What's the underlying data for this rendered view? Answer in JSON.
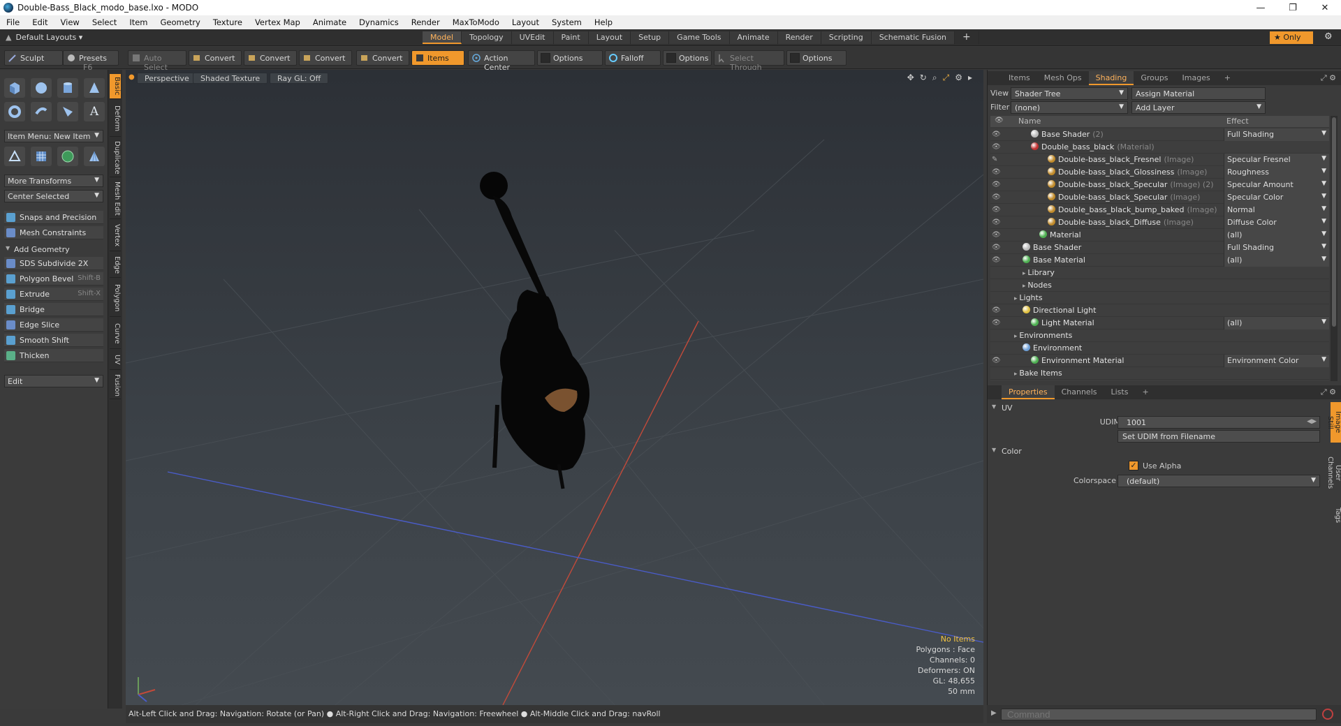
{
  "window": {
    "title": "Double-Bass_Black_modo_base.lxo - MODO",
    "minimize": "—",
    "maximize": "❐",
    "close": "✕"
  },
  "menu": [
    "File",
    "Edit",
    "View",
    "Select",
    "Item",
    "Geometry",
    "Texture",
    "Vertex Map",
    "Animate",
    "Dynamics",
    "Render",
    "MaxToModo",
    "Layout",
    "System",
    "Help"
  ],
  "layoutbar": {
    "default_layouts": "Default Layouts ▾",
    "tabs": [
      "Model",
      "Topology",
      "UVEdit",
      "Paint",
      "Layout",
      "Setup",
      "Game Tools",
      "Animate",
      "Render",
      "Scripting",
      "Schematic Fusion"
    ],
    "active_tab": "Model",
    "add": "+",
    "only": "★  Only",
    "gear": "⚙"
  },
  "toolbar": {
    "sculpt": "Sculpt",
    "presets": "Presets",
    "presets_key": "F6",
    "auto_select": "Auto Select",
    "convert1": "Convert",
    "convert2": "Convert",
    "convert3": "Convert",
    "convert4": "Convert",
    "items": "Items",
    "action_center": "Action Center",
    "options1": "Options",
    "falloff": "Falloff",
    "options2": "Options",
    "select_through": "Select Through",
    "options3": "Options"
  },
  "leftpanel": {
    "item_menu": "Item Menu: New Item",
    "more_transforms": "More Transforms",
    "center_selected": "Center Selected",
    "snaps": "Snaps and Precision",
    "mesh_constraints": "Mesh Constraints",
    "add_geometry": "Add Geometry",
    "tools": [
      {
        "label": "SDS Subdivide 2X",
        "key": "",
        "color": "#6a8cc8"
      },
      {
        "label": "Polygon Bevel",
        "key": "Shift-B",
        "color": "#5aa0d0"
      },
      {
        "label": "Extrude",
        "key": "Shift-X",
        "color": "#5aa0d0"
      },
      {
        "label": "Bridge",
        "key": "",
        "color": "#5aa0d0"
      },
      {
        "label": "Edge Slice",
        "key": "",
        "color": "#6a8cc8"
      },
      {
        "label": "Smooth Shift",
        "key": "",
        "color": "#5aa0d0"
      },
      {
        "label": "Thicken",
        "key": "",
        "color": "#5ab088"
      }
    ],
    "edit": "Edit",
    "vtabs": [
      "Basic",
      "Deform",
      "Duplicate",
      "Mesh Edit",
      "Vertex",
      "Edge",
      "Polygon",
      "Curve",
      "UV",
      "Fusion"
    ]
  },
  "viewport": {
    "perspective": "Perspective",
    "shading": "Shaded Texture",
    "raygl": "Ray GL: Off",
    "info": {
      "no_items": "No Items",
      "polygons": "Polygons : Face",
      "channels": "Channels: 0",
      "deformers": "Deformers: ON",
      "gl": "GL: 48,655",
      "lens": "50 mm"
    }
  },
  "statusbar": "Alt-Left Click and Drag: Navigation: Rotate (or Pan) ● Alt-Right Click and Drag: Navigation: Freewheel ● Alt-Middle Click and Drag: navRoll",
  "rightpanel": {
    "tabs": [
      "Items",
      "Mesh Ops",
      "Shading",
      "Groups",
      "Images"
    ],
    "active_tab": "Shading",
    "view_label": "View",
    "view_value": "Shader Tree",
    "assign_material": "Assign Material",
    "filter_label": "Filter",
    "filter_value": "(none)",
    "add_layer": "Add Layer",
    "col_name": "Name",
    "col_effect": "Effect",
    "rows": [
      {
        "name": "Base Shader",
        "sub": "(2)",
        "effect": "Full Shading",
        "indent": 58,
        "ball": "#bbbbbb",
        "eye": "👁"
      },
      {
        "name": "Double_bass_black",
        "sub": "(Material)",
        "effect": "",
        "indent": 58,
        "ball": "#c03030",
        "eye": "👁"
      },
      {
        "name": "Double-bass_black_Fresnel",
        "sub": "(Image)",
        "effect": "Specular Fresnel",
        "indent": 82,
        "ball": "#c08a2a",
        "eye": "✎"
      },
      {
        "name": "Double-bass_black_Glossiness",
        "sub": "(Image)",
        "effect": "Roughness",
        "indent": 82,
        "ball": "#c08a2a",
        "eye": "👁"
      },
      {
        "name": "Double-bass_black_Specular",
        "sub": "(Image) (2)",
        "effect": "Specular Amount",
        "indent": 82,
        "ball": "#c08a2a",
        "eye": "👁"
      },
      {
        "name": "Double-bass_black_Specular",
        "sub": "(Image)",
        "effect": "Specular Color",
        "indent": 82,
        "ball": "#c08a2a",
        "eye": "👁"
      },
      {
        "name": "Double_bass_black_bump_baked",
        "sub": "(Image)",
        "effect": "Normal",
        "indent": 82,
        "ball": "#c08a2a",
        "eye": "👁"
      },
      {
        "name": "Double-bass_black_Diffuse",
        "sub": "(Image)",
        "effect": "Diffuse Color",
        "indent": 82,
        "ball": "#c08a2a",
        "eye": "👁"
      },
      {
        "name": "Material",
        "sub": "",
        "effect": "(all)",
        "indent": 70,
        "ball": "#4caf50",
        "eye": "👁"
      },
      {
        "name": "Base Shader",
        "sub": "",
        "effect": "Full Shading",
        "indent": 46,
        "ball": "#bbbbbb",
        "eye": "👁"
      },
      {
        "name": "Base Material",
        "sub": "",
        "effect": "(all)",
        "indent": 46,
        "ball": "#4caf50",
        "eye": "👁"
      },
      {
        "name": "Library",
        "sub": "",
        "effect": "",
        "indent": 46,
        "ball": "",
        "eye": ""
      },
      {
        "name": "Nodes",
        "sub": "",
        "effect": "",
        "indent": 46,
        "ball": "",
        "eye": ""
      },
      {
        "name": "Lights",
        "sub": "",
        "effect": "",
        "indent": 34,
        "ball": "",
        "eye": ""
      },
      {
        "name": "Directional Light",
        "sub": "",
        "effect": "",
        "indent": 46,
        "ball": "#e0c040",
        "eye": "👁"
      },
      {
        "name": "Light Material",
        "sub": "",
        "effect": "(all)",
        "indent": 58,
        "ball": "#4caf50",
        "eye": "👁"
      },
      {
        "name": "Environments",
        "sub": "",
        "effect": "",
        "indent": 34,
        "ball": "",
        "eye": ""
      },
      {
        "name": "Environment",
        "sub": "",
        "effect": "",
        "indent": 46,
        "ball": "#6fa0d8",
        "eye": ""
      },
      {
        "name": "Environment Material",
        "sub": "",
        "effect": "Environment Color",
        "indent": 58,
        "ball": "#4caf50",
        "eye": "👁"
      },
      {
        "name": "Bake Items",
        "sub": "",
        "effect": "",
        "indent": 34,
        "ball": "",
        "eye": ""
      }
    ],
    "prop_tabs": [
      "Properties",
      "Channels",
      "Lists"
    ],
    "active_prop_tab": "Properties",
    "uv_section": "UV",
    "udim_label": "UDIM",
    "udim_value": "1001",
    "set_udim": "Set UDIM from Filename",
    "color_section": "Color",
    "use_alpha": "Use Alpha",
    "colorspace_label": "Colorspace",
    "colorspace_value": "(default)",
    "side_tabs": [
      "Image Still",
      "User Channels",
      "Tags"
    ],
    "command_placeholder": "Command"
  }
}
